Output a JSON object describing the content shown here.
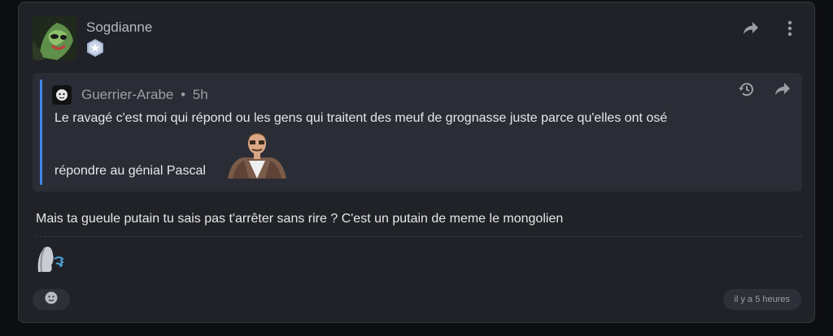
{
  "author": {
    "username": "Sogdianne"
  },
  "quote": {
    "author": "Guerrier-Arabe",
    "separator": "•",
    "age": "5h",
    "line1": "Le ravagé c'est moi qui répond ou les gens qui traitent des meuf de grognasse juste parce qu'elles ont osé",
    "line2": "répondre au génial Pascal"
  },
  "message": "Mais ta gueule putain tu sais pas t'arrêter sans rire ? C'est un putain de meme le mongolien",
  "timestamp": "il y a 5 heures",
  "colors": {
    "card": "#202228",
    "quote_bg": "#2a2d35",
    "quote_bar": "#3f86e8",
    "chip": "#2d3038"
  },
  "icons": [
    "share-icon",
    "more-vertical-icon",
    "history-icon",
    "share-icon",
    "emoji-add-icon",
    "star-badge-icon"
  ]
}
